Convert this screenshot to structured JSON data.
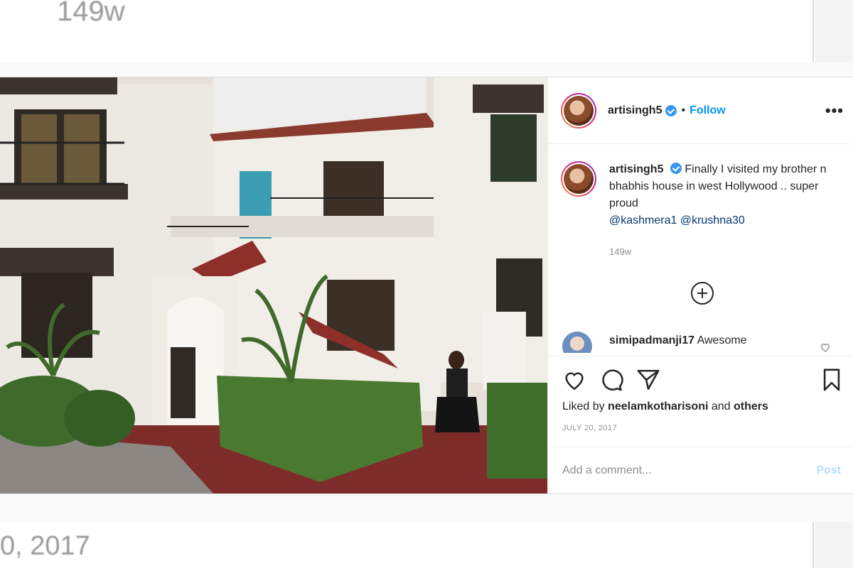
{
  "background": {
    "top_time": "149w",
    "bottom_date": "0, 2017"
  },
  "header": {
    "username": "artisingh5",
    "separator": "•",
    "follow_label": "Follow",
    "more_label": "•••"
  },
  "caption": {
    "username": "artisingh5",
    "text": "Finally I visited my brother n bhabhis house in west Hollywood .. super proud",
    "mentions": [
      "@kashmera1",
      "@krushna30"
    ],
    "time": "149w"
  },
  "comment": {
    "username": "simipadmanji17",
    "text": "Awesome"
  },
  "actions": {
    "liked_by_prefix": "Liked by",
    "liked_by_user": "neelamkotharisoni",
    "liked_by_and": "and",
    "liked_by_others": "others",
    "date": "JULY 20, 2017"
  },
  "add_comment": {
    "placeholder": "Add a comment...",
    "post_label": "Post"
  },
  "colors": {
    "accent": "#0095f6",
    "verified": "#3897f0",
    "muted": "#8e8e8e"
  },
  "icons": [
    "verified-icon",
    "more-options-icon",
    "add-circle-icon",
    "heart-icon",
    "comment-icon",
    "share-icon",
    "bookmark-icon"
  ]
}
